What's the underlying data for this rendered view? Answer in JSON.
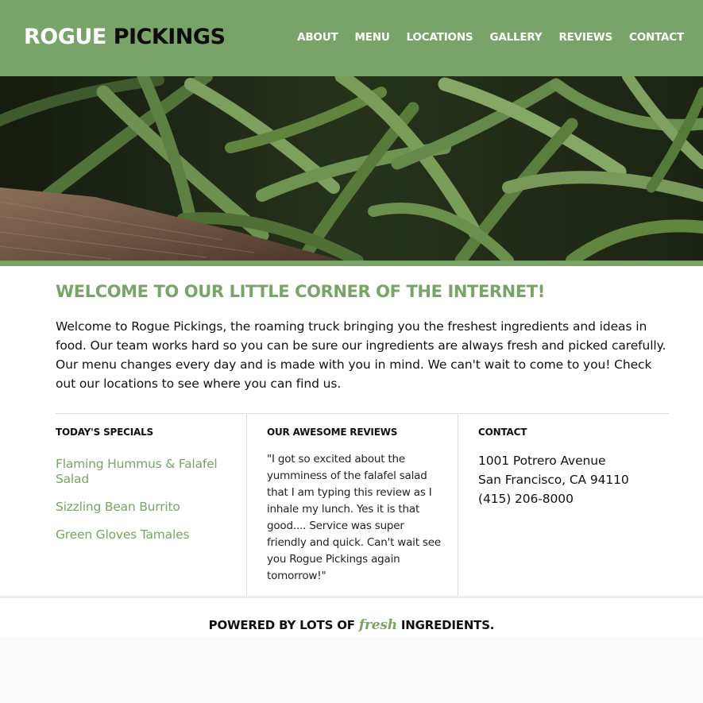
{
  "header": {
    "logo_white": "ROGUE",
    "logo_black": "PICKINGS",
    "nav": [
      {
        "label": "ABOUT"
      },
      {
        "label": "MENU"
      },
      {
        "label": "LOCATIONS"
      },
      {
        "label": "GALLERY"
      },
      {
        "label": "REVIEWS"
      },
      {
        "label": "CONTACT"
      }
    ]
  },
  "colors": {
    "brand_green": "#79a368",
    "text_dark": "#111111",
    "white": "#ffffff"
  },
  "welcome": {
    "title": "WELCOME TO OUR LITTLE CORNER OF THE INTERNET!",
    "text": "Welcome to Rogue Pickings, the roaming truck bringing you the freshest ingredients and ideas in food. Our team works hard so you can be sure our ingredients are always fresh and picked carefully. Our menu changes every day and is made with you in mind. We can't wait to come to you! Check out our locations to see where you can find us."
  },
  "specials": {
    "title": "TODAY'S SPECIALS",
    "items": [
      {
        "label": "Flaming Hummus & Falafel Salad"
      },
      {
        "label": "Sizzling Bean Burrito"
      },
      {
        "label": "Green Gloves Tamales"
      }
    ]
  },
  "reviews": {
    "title": "OUR AWESOME REVIEWS",
    "text": "\"I got so excited about the yumminess of the falafel salad that I am typing this review as I inhale my lunch. Yes it is that good.... Service was super friendly and quick. Can't wait see you Rogue Pickings again tomorrow!\""
  },
  "contact": {
    "title": "CONTACT",
    "address_line1": "1001 Potrero Avenue",
    "address_line2": "San Francisco, CA 94110",
    "phone": "(415) 206-8000"
  },
  "footer": {
    "before": "POWERED BY LOTS OF ",
    "fresh": "fresh",
    "after": " INGREDIENTS."
  }
}
